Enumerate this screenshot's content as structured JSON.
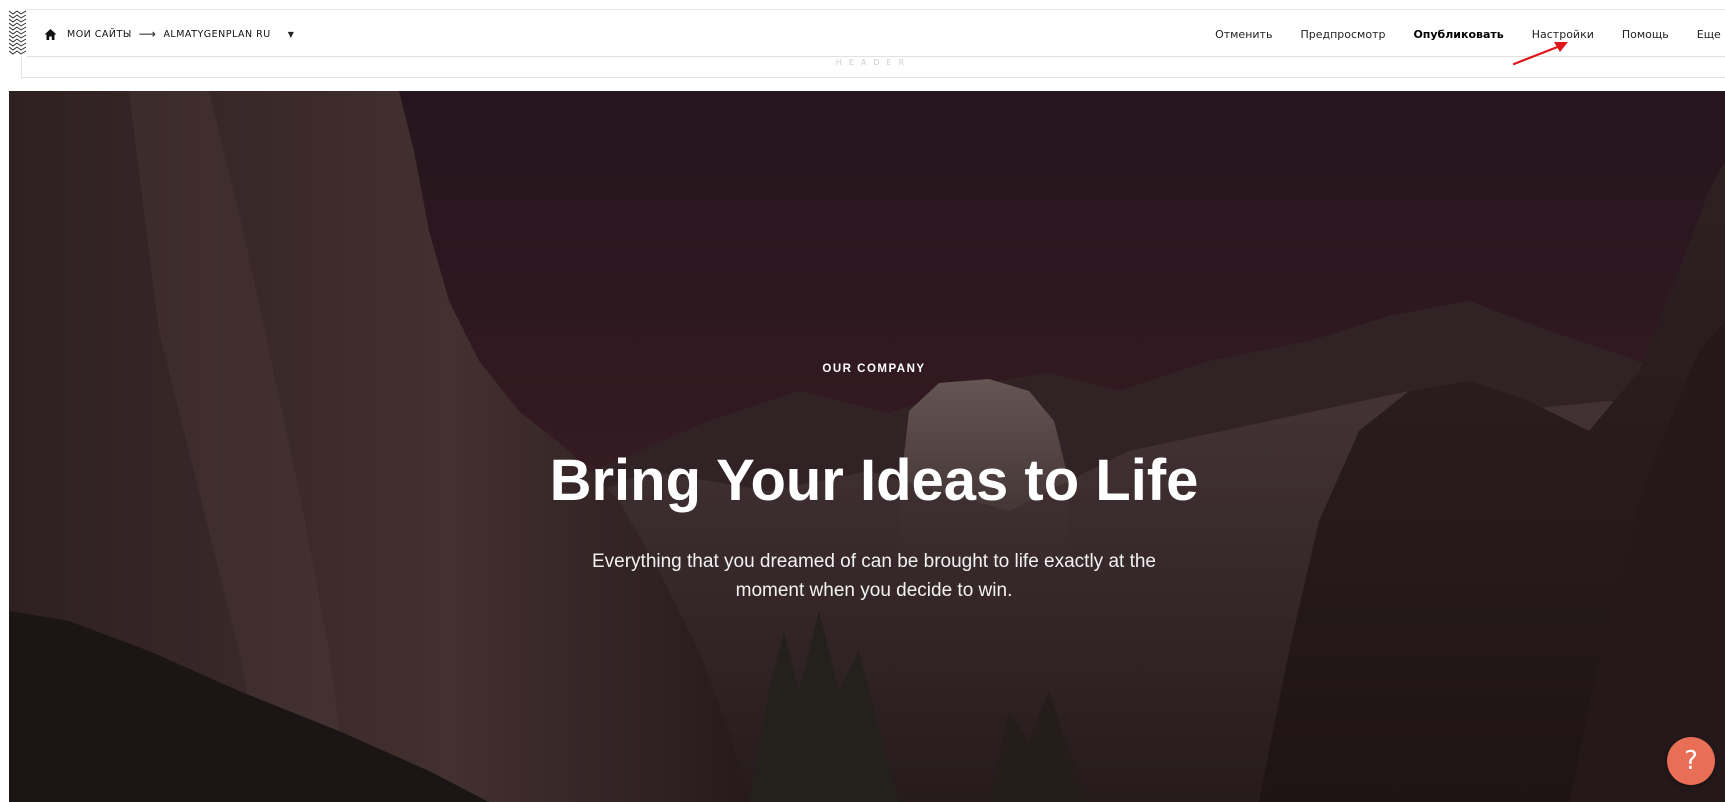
{
  "toolbar": {
    "icons": {
      "home": "home-icon",
      "caret": "caret-down-icon"
    },
    "breadcrumb": {
      "root": "МОИ САЙТЫ",
      "separator": "⟶",
      "site": "ALMATYGENPLAN RU"
    },
    "menu": {
      "cancel": "Отменить",
      "preview": "Предпросмотр",
      "publish": "Опубликовать",
      "settings": "Настройки",
      "help": "Помощь",
      "more": "Еще"
    }
  },
  "header_section": {
    "label": "HEADER"
  },
  "hero": {
    "eyebrow": "OUR COMPANY",
    "title": "Bring Your Ideas to Life",
    "subtitle": "Everything that you dreamed of can be brought to life exactly at the moment when you decide to win."
  },
  "help_button": {
    "label": "?",
    "color": "#e86f55"
  },
  "annotation": {
    "arrow_color": "#e0161b",
    "points_to": "settings"
  }
}
